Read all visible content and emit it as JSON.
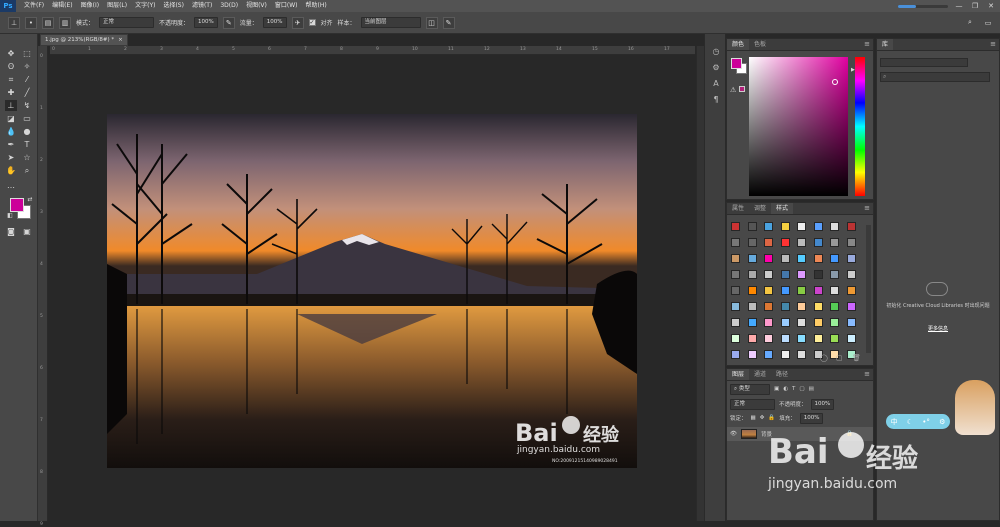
{
  "app": {
    "logo": "Ps"
  },
  "menu": [
    "文件(F)",
    "编辑(E)",
    "图像(I)",
    "图层(L)",
    "文字(Y)",
    "选择(S)",
    "滤镜(T)",
    "3D(D)",
    "视图(V)",
    "窗口(W)",
    "帮助(H)"
  ],
  "progress": {
    "fraction": 0.35
  },
  "options": {
    "mode_label": "模式：",
    "mode_value": "正常",
    "opacity_label": "不透明度：",
    "opacity_value": "100%",
    "flow_label": "流量：",
    "flow_value": "100%",
    "align_label": "对齐",
    "sample_label": "样本：",
    "sample_value": "当前图层"
  },
  "document": {
    "tab_title": "1.jpg @ 213%(RGB/8#) *",
    "close": "×"
  },
  "ruler_h": [
    "0",
    "1",
    "2",
    "3",
    "4",
    "5",
    "6",
    "7",
    "8",
    "9",
    "10",
    "11",
    "12",
    "13",
    "14",
    "15",
    "16",
    "17"
  ],
  "ruler_v": [
    "0",
    "1",
    "2",
    "3",
    "4",
    "5",
    "6",
    "7",
    "8",
    "9"
  ],
  "panels": {
    "color": {
      "tabs": [
        "颜色",
        "色板"
      ],
      "fg": "#cc0099",
      "bg": "#ffffff"
    },
    "styles": {
      "tabs": [
        "属性",
        "调整",
        "样式"
      ]
    },
    "layers": {
      "tabs": [
        "图层",
        "通道",
        "路径"
      ],
      "kind_label": "类型",
      "blend_mode": "正常",
      "opacity_label": "不透明度：",
      "opacity_value": "100%",
      "lock_label": "锁定：",
      "fill_label": "填充：",
      "fill_value": "100%",
      "layer_name": "背景"
    },
    "library": {
      "tab": "库",
      "message": "初始化 Creative Cloud Libraries 时出现问题",
      "link": "更多信息"
    }
  },
  "watermark": {
    "brand": "Bai",
    "brand_cn": "经验",
    "url": "jingyan.baidu.com",
    "photo_no": "NO:20091215140989028491"
  },
  "colors": {
    "accent": "#31a8ff",
    "selection": "#4a90d9"
  }
}
